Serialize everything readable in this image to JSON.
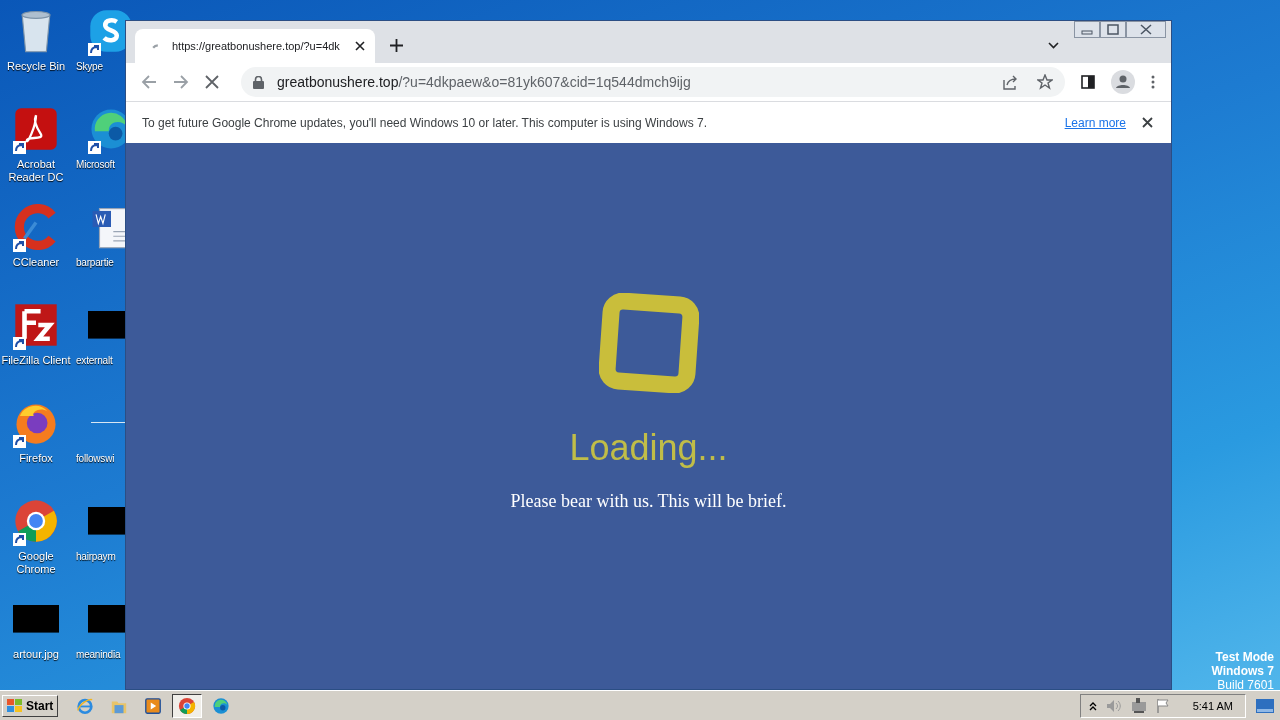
{
  "desktop": {
    "icons": [
      {
        "label": "Recycle Bin",
        "kind": "recycle",
        "shortcut": false
      },
      {
        "label": "Skype",
        "kind": "skype",
        "shortcut": true
      },
      {
        "label": "Acrobat Reader DC",
        "kind": "acrobat",
        "shortcut": true
      },
      {
        "label": "Microsoft",
        "kind": "edge",
        "shortcut": true
      },
      {
        "label": "CCleaner",
        "kind": "ccleaner",
        "shortcut": true
      },
      {
        "label": "barpartie",
        "kind": "word",
        "shortcut": false
      },
      {
        "label": "FileZilla Client",
        "kind": "filezilla",
        "shortcut": true
      },
      {
        "label": "externalt",
        "kind": "blackbox",
        "shortcut": false
      },
      {
        "label": "Firefox",
        "kind": "firefox",
        "shortcut": true
      },
      {
        "label": "followswi",
        "kind": "line",
        "shortcut": false
      },
      {
        "label": "Google Chrome",
        "kind": "chrome",
        "shortcut": true
      },
      {
        "label": "hairpaym",
        "kind": "blackbox",
        "shortcut": false
      },
      {
        "label": "artour.jpg",
        "kind": "blackbox",
        "shortcut": false
      },
      {
        "label": "meanindia",
        "kind": "blackbox",
        "shortcut": false
      }
    ],
    "test_mode_notice": [
      "Test Mode",
      "Windows 7",
      "Build 7601"
    ]
  },
  "browser": {
    "tab": {
      "title": "https://greatbonushere.top/?u=4dk",
      "loading": true
    },
    "address": {
      "host": "greatbonushere.top",
      "path": "/?u=4dkpaew&o=81yk607&cid=1q544dmch9ijg"
    },
    "infobar": {
      "message": "To get future Google Chrome updates, you'll need Windows 10 or later. This computer is using Windows 7.",
      "link": "Learn more"
    },
    "page": {
      "heading": "Loading...",
      "message": "Please bear with us. This will be brief."
    }
  },
  "taskbar": {
    "start": "Start",
    "apps": [
      {
        "kind": "ie",
        "selected": false
      },
      {
        "kind": "explorer",
        "selected": false
      },
      {
        "kind": "media",
        "selected": false
      },
      {
        "kind": "chrome",
        "selected": true
      },
      {
        "kind": "edge",
        "selected": false
      }
    ],
    "clock": "5:41 AM"
  }
}
